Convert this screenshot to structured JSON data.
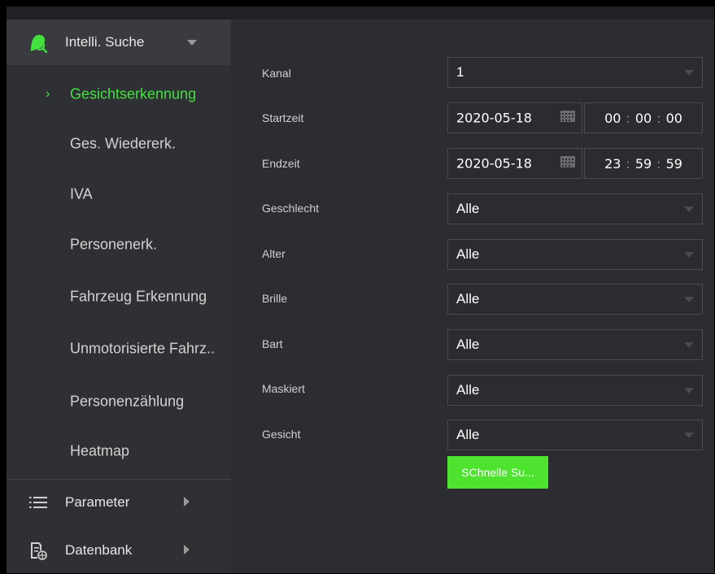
{
  "colors": {
    "accent_green": "#43e13e",
    "button_green": "#4ee32f",
    "sidebar_bg": "#2f3034",
    "content_bg": "#2c2d31"
  },
  "sidebar": {
    "section": {
      "label": "Intelli. Suche",
      "icon": "face-search-icon",
      "expanded": true
    },
    "items": [
      {
        "label": "Gesichtserkennung",
        "selected": true
      },
      {
        "label": "Ges. Wiedererk."
      },
      {
        "label": "IVA"
      },
      {
        "label": "Personenerk."
      },
      {
        "label": "Fahrzeug Erkennung"
      },
      {
        "label": "Unmotorisierte Fahrz.."
      },
      {
        "label": "Personenzählung"
      },
      {
        "label": "Heatmap"
      }
    ],
    "parameter": {
      "label": "Parameter",
      "icon": "list-icon"
    },
    "datenbank": {
      "label": "Datenbank",
      "icon": "database-icon"
    }
  },
  "form": {
    "kanal": {
      "label": "Kanal",
      "value": "1"
    },
    "startzeit": {
      "label": "Startzeit",
      "date": "2020-05-18",
      "hh": "00",
      "mm": "00",
      "ss": "00"
    },
    "endzeit": {
      "label": "Endzeit",
      "date": "2020-05-18",
      "hh": "23",
      "mm": "59",
      "ss": "59"
    },
    "geschlecht": {
      "label": "Geschlecht",
      "value": "Alle"
    },
    "alter": {
      "label": "Alter",
      "value": "Alle"
    },
    "brille": {
      "label": "Brille",
      "value": "Alle"
    },
    "bart": {
      "label": "Bart",
      "value": "Alle"
    },
    "maskiert": {
      "label": "Maskiert",
      "value": "Alle"
    },
    "gesicht": {
      "label": "Gesicht",
      "value": "Alle"
    },
    "search_button": "SChnelle Su..."
  }
}
